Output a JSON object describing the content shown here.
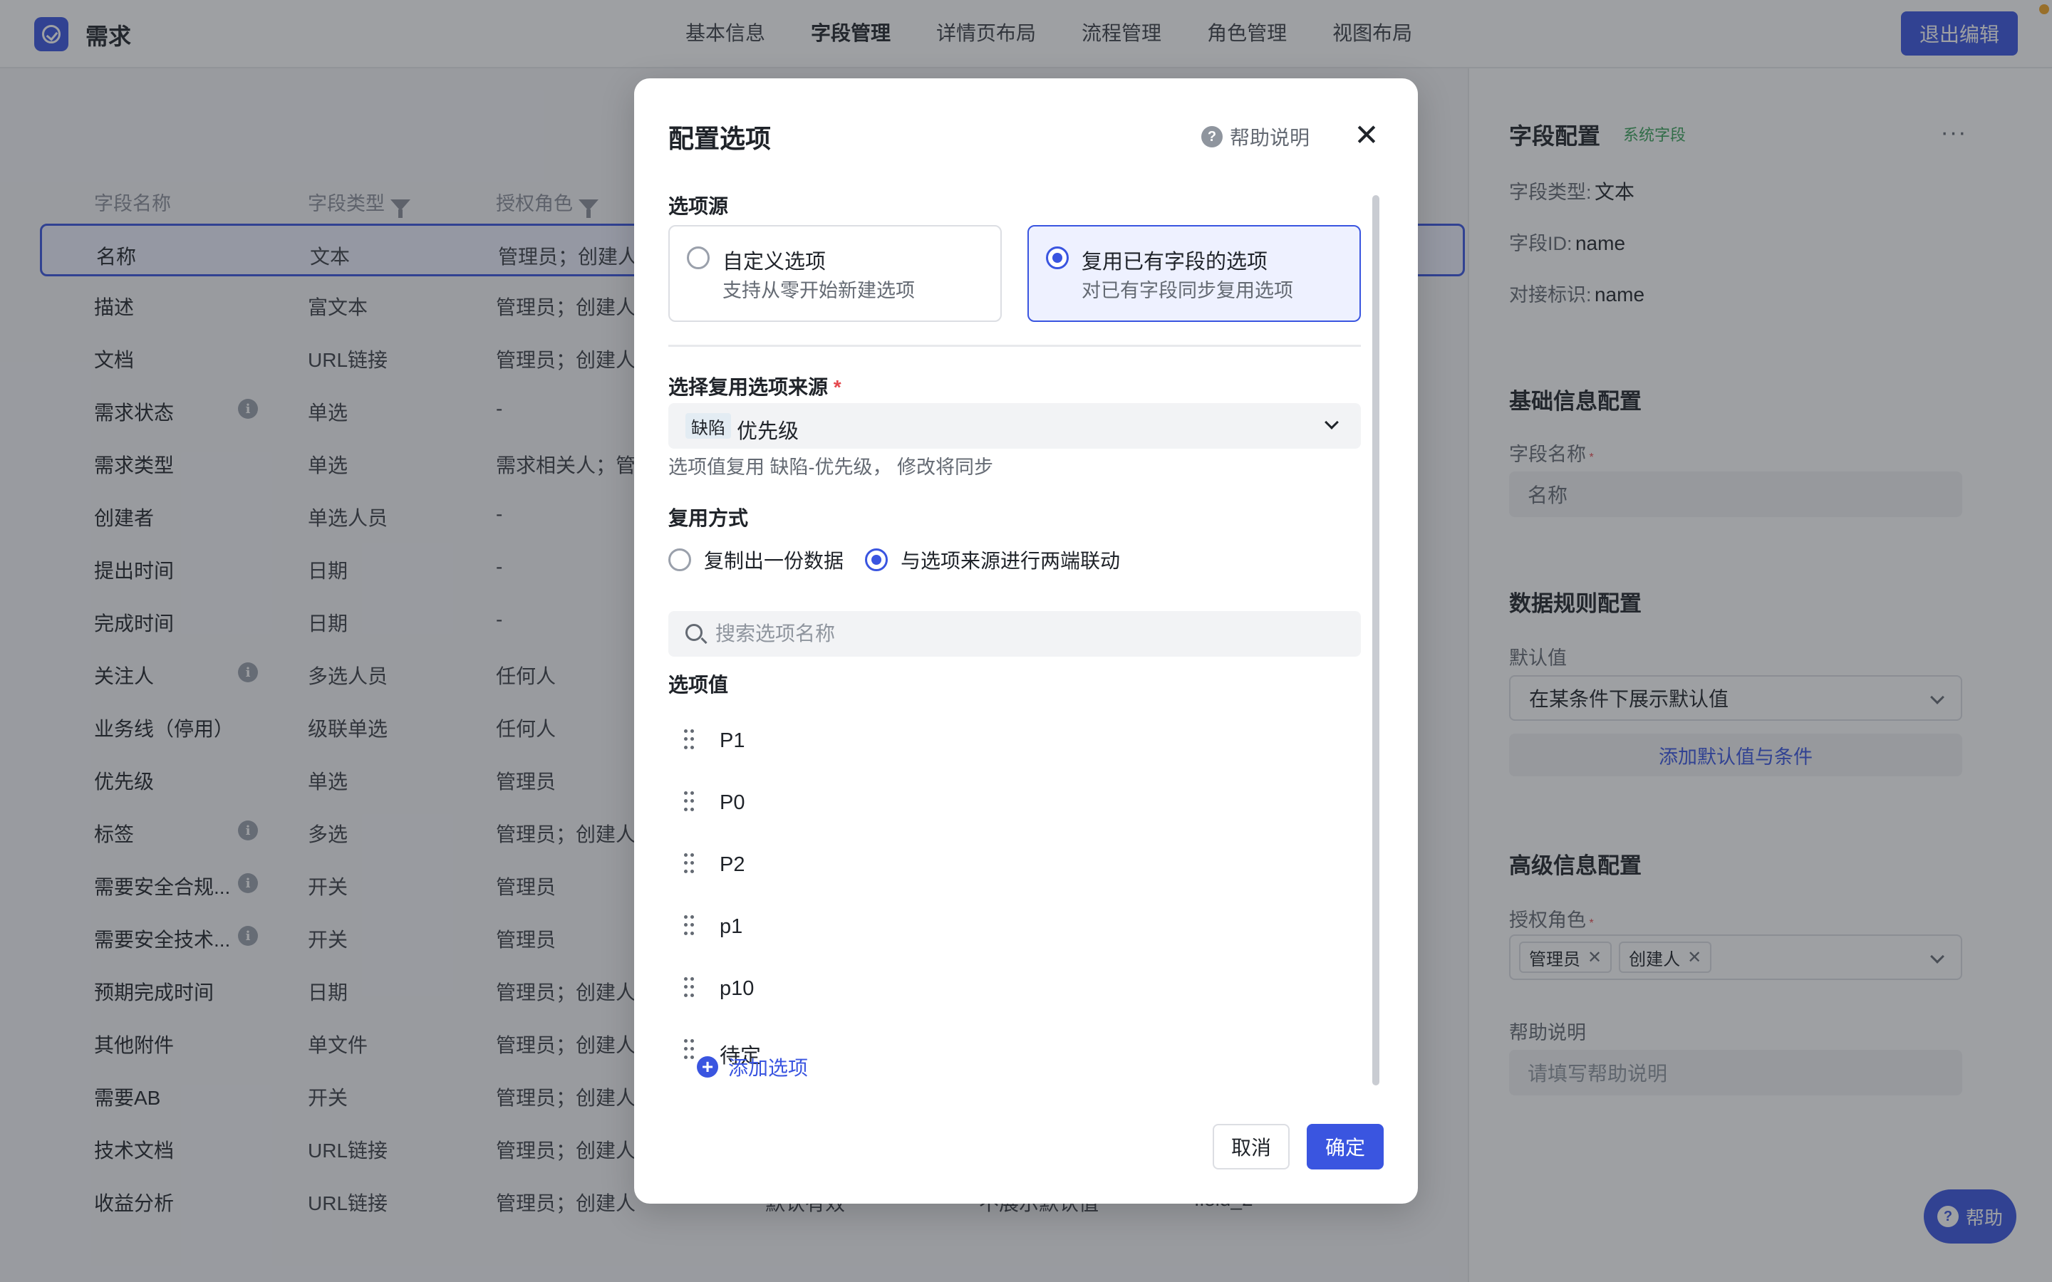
{
  "app": {
    "title": "需求",
    "exit_label": "退出编辑"
  },
  "nav": {
    "tabs": [
      "基本信息",
      "字段管理",
      "详情页布局",
      "流程管理",
      "角色管理",
      "视图布局"
    ],
    "active": 1
  },
  "table": {
    "headers": {
      "name": "字段名称",
      "type": "字段类型",
      "role": "授权角色"
    },
    "rows": [
      {
        "name": "名称",
        "type": "文本",
        "role": "管理员；创建人",
        "info": false,
        "selected": true
      },
      {
        "name": "描述",
        "type": "富文本",
        "role": "管理员；创建人",
        "info": false
      },
      {
        "name": "文档",
        "type": "URL链接",
        "role": "管理员；创建人",
        "info": false
      },
      {
        "name": "需求状态",
        "type": "单选",
        "role": "-",
        "info": true
      },
      {
        "name": "需求类型",
        "type": "单选",
        "role": "需求相关人；管",
        "info": false
      },
      {
        "name": "创建者",
        "type": "单选人员",
        "role": "-",
        "info": false
      },
      {
        "name": "提出时间",
        "type": "日期",
        "role": "-",
        "info": false
      },
      {
        "name": "完成时间",
        "type": "日期",
        "role": "-",
        "info": false
      },
      {
        "name": "关注人",
        "type": "多选人员",
        "role": "任何人",
        "info": true
      },
      {
        "name": "业务线（停用）",
        "type": "级联单选",
        "role": "任何人",
        "info": false
      },
      {
        "name": "优先级",
        "type": "单选",
        "role": "管理员",
        "info": false
      },
      {
        "name": "标签",
        "type": "多选",
        "role": "管理员；创建人",
        "info": true
      },
      {
        "name": "需要安全合规...",
        "type": "开关",
        "role": "管理员",
        "info": true
      },
      {
        "name": "需要安全技术...",
        "type": "开关",
        "role": "管理员",
        "info": true
      },
      {
        "name": "预期完成时间",
        "type": "日期",
        "role": "管理员；创建人",
        "info": false
      },
      {
        "name": "其他附件",
        "type": "单文件",
        "role": "管理员；创建人",
        "info": false
      },
      {
        "name": "需要AB",
        "type": "开关",
        "role": "管理员；创建人",
        "info": false
      },
      {
        "name": "技术文档",
        "type": "URL链接",
        "role": "管理员；创建人",
        "info": false
      },
      {
        "name": "收益分析",
        "type": "URL链接",
        "role": "管理员；创建人",
        "info": false,
        "extra": [
          "默认有效",
          "不展示默认值",
          "field_2"
        ]
      }
    ]
  },
  "side": {
    "title": "字段配置",
    "tag": "系统字段",
    "type_label": "字段类型:",
    "type_value": "文本",
    "id_label": "字段ID:",
    "id_value": "name",
    "key_label": "对接标识:",
    "key_value": "name",
    "basic_section": "基础信息配置",
    "name_label": "字段名称",
    "name_value": "名称",
    "rules_section": "数据规则配置",
    "default_label": "默认值",
    "default_select": "在某条件下展示默认值",
    "add_default": "添加默认值与条件",
    "advanced_section": "高级信息配置",
    "roles_label": "授权角色",
    "roles": [
      "管理员",
      "创建人"
    ],
    "help_label": "帮助说明",
    "help_placeholder": "请填写帮助说明",
    "more": "···"
  },
  "help_float": "帮助",
  "modal": {
    "title": "配置选项",
    "help": "帮助说明",
    "close": "✕",
    "source_label": "选项源",
    "source_options": [
      {
        "title": "自定义选项",
        "desc": "支持从零开始新建选项",
        "selected": false
      },
      {
        "title": "复用已有字段的选项",
        "desc": "对已有字段同步复用选项",
        "selected": true
      }
    ],
    "reuse_source_label": "选择复用选项来源",
    "required_mark": "*",
    "reuse_source_tag": "缺陷",
    "reuse_source_value": "优先级",
    "reuse_hint": "选项值复用 缺陷-优先级， 修改将同步",
    "reuse_mode_label": "复用方式",
    "reuse_modes": [
      {
        "label": "复制出一份数据",
        "selected": false
      },
      {
        "label": "与选项来源进行两端联动",
        "selected": true
      }
    ],
    "search_placeholder": "搜索选项名称",
    "values_label": "选项值",
    "values": [
      "P1",
      "P0",
      "P2",
      "p1",
      "p10",
      "待定"
    ],
    "add_option": "添加选项",
    "cancel": "取消",
    "confirm": "确定"
  }
}
